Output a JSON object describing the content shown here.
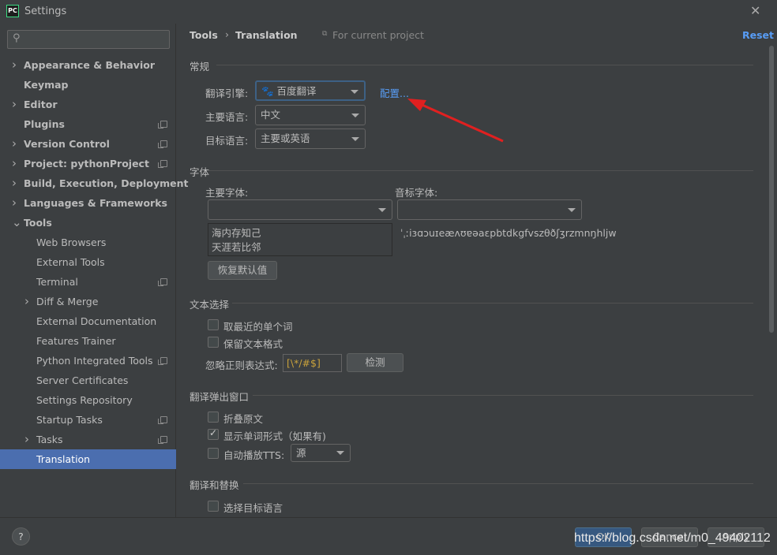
{
  "window": {
    "title": "Settings",
    "logo": "PC"
  },
  "sidebar": {
    "search_placeholder": "",
    "items": [
      {
        "label": "Appearance & Behavior",
        "bold": true,
        "chevron": "right",
        "copy": false
      },
      {
        "label": "Keymap",
        "bold": true,
        "chevron": "",
        "copy": false
      },
      {
        "label": "Editor",
        "bold": true,
        "chevron": "right",
        "copy": false
      },
      {
        "label": "Plugins",
        "bold": true,
        "chevron": "",
        "copy": true
      },
      {
        "label": "Version Control",
        "bold": true,
        "chevron": "right",
        "copy": true
      },
      {
        "label": "Project: pythonProject",
        "bold": true,
        "chevron": "right",
        "copy": true
      },
      {
        "label": "Build, Execution, Deployment",
        "bold": true,
        "chevron": "right",
        "copy": false
      },
      {
        "label": "Languages & Frameworks",
        "bold": true,
        "chevron": "right",
        "copy": false
      },
      {
        "label": "Tools",
        "bold": true,
        "chevron": "down",
        "copy": false
      },
      {
        "label": "Web Browsers",
        "child": true,
        "copy": false
      },
      {
        "label": "External Tools",
        "child": true,
        "copy": false
      },
      {
        "label": "Terminal",
        "child": true,
        "copy": true
      },
      {
        "label": "Diff & Merge",
        "child": true,
        "chevron": "right",
        "copy": false
      },
      {
        "label": "External Documentation",
        "child": true,
        "copy": false
      },
      {
        "label": "Features Trainer",
        "child": true,
        "copy": false
      },
      {
        "label": "Python Integrated Tools",
        "child": true,
        "copy": true
      },
      {
        "label": "Server Certificates",
        "child": true,
        "copy": false
      },
      {
        "label": "Settings Repository",
        "child": true,
        "copy": false
      },
      {
        "label": "Startup Tasks",
        "child": true,
        "copy": true
      },
      {
        "label": "Tasks",
        "child": true,
        "chevron": "right",
        "copy": true
      },
      {
        "label": "Translation",
        "child": true,
        "selected": true,
        "copy": false
      }
    ]
  },
  "header": {
    "breadcrumb": [
      "Tools",
      "Translation"
    ],
    "scope": "For current project",
    "reset": "Reset"
  },
  "general": {
    "title": "常规",
    "engine_label": "翻译引擎:",
    "engine_value": "百度翻译",
    "configure": "配置...",
    "primary_lang_label": "主要语言:",
    "primary_lang_value": "中文",
    "target_lang_label": "目标语言:",
    "target_lang_value": "主要或英语"
  },
  "font": {
    "title": "字体",
    "primary_label": "主要字体:",
    "phonetic_label": "音标字体:",
    "primary_value": "",
    "phonetic_value": "",
    "preview_line1": "海内存知己",
    "preview_line2": "天涯若比邻",
    "phonetic_preview": "ˈˌːiɜɑɔuɪeæʌʊɐəaɛpbtdkgfvszθðʃʒrzmnŋhljw",
    "restore": "恢复默认值"
  },
  "text_selection": {
    "title": "文本选择",
    "nearest_word": "取最近的单个词",
    "nearest_word_checked": false,
    "keep_format": "保留文本格式",
    "keep_format_checked": false,
    "regex_label": "忽略正则表达式:",
    "regex_value": "[\\*/#$]",
    "check": "检测"
  },
  "popup": {
    "title": "翻译弹出窗口",
    "fold_original": "折叠原文",
    "fold_checked": false,
    "show_word_forms": "显示单词形式（如果有)",
    "show_checked": true,
    "autoplay": "自动播放TTS:",
    "autoplay_checked": false,
    "tts_source": "源"
  },
  "replace": {
    "title": "翻译和替换",
    "select_target": "选择目标语言",
    "select_checked": false
  },
  "footer": {
    "help": "?",
    "ok": "OK",
    "cancel": "Cancel",
    "apply": "Apply",
    "watermark": "https://blog.csdn.net/m0_49402112"
  },
  "colors": {
    "selection": "#4b6eaf",
    "link": "#589df6",
    "annotation_arrow": "#e02020"
  }
}
